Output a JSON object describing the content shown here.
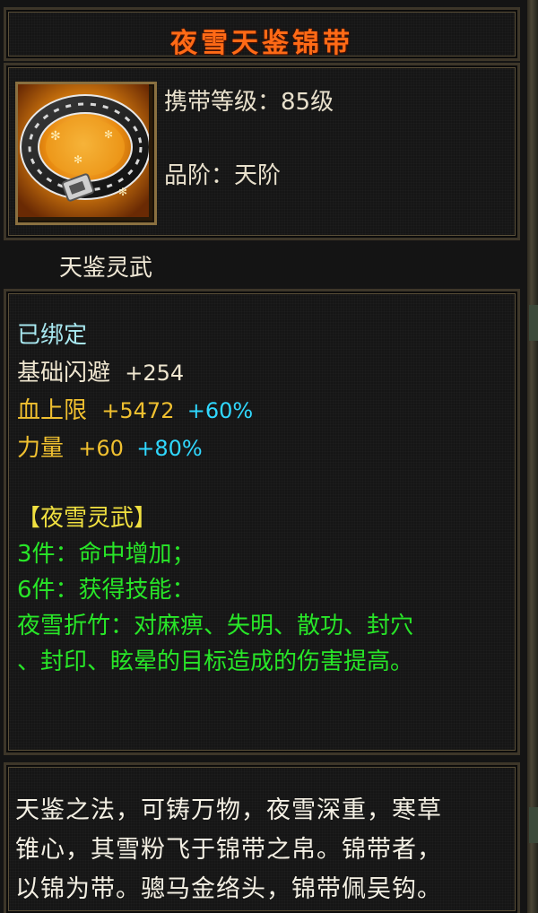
{
  "item": {
    "name": "夜雪天鉴锦带",
    "icon": "belt-icon",
    "level_label": "携带等级：",
    "level_value": "85级",
    "grade_label": "品阶：",
    "grade_value": "天阶",
    "series": "天鉴灵武"
  },
  "stats": {
    "bound": "已绑定",
    "base_dodge_label": "基础闪避",
    "base_dodge_value": "+254",
    "hp_label": "血上限",
    "hp_value": "+5472",
    "hp_pct": "+60%",
    "str_label": "力量",
    "str_value": "+60",
    "str_pct": "+80%"
  },
  "set": {
    "name": "【夜雪灵武】",
    "bonus3": "3件：命中增加；",
    "bonus6": "6件：获得技能：",
    "skill_line1": "夜雪折竹：对麻痹、失明、散功、封穴",
    "skill_line2": "、封印、眩晕的目标造成的伤害提高。"
  },
  "description": {
    "line1": "天鉴之法，可铸万物，夜雪深重，寒草",
    "line2": "锥心，其雪粉飞于锦带之帛。锦带者，",
    "line3": "以锦为带。骢马金络头，锦带佩吴钩。"
  },
  "colors": {
    "title": "#ff6a16",
    "base_stat": "#efe6d0",
    "gold_stat": "#f0c030",
    "percent": "#30d8ff",
    "set_name": "#f0e040",
    "set_bonus": "#28e628",
    "bound": "#a8e8f0"
  }
}
